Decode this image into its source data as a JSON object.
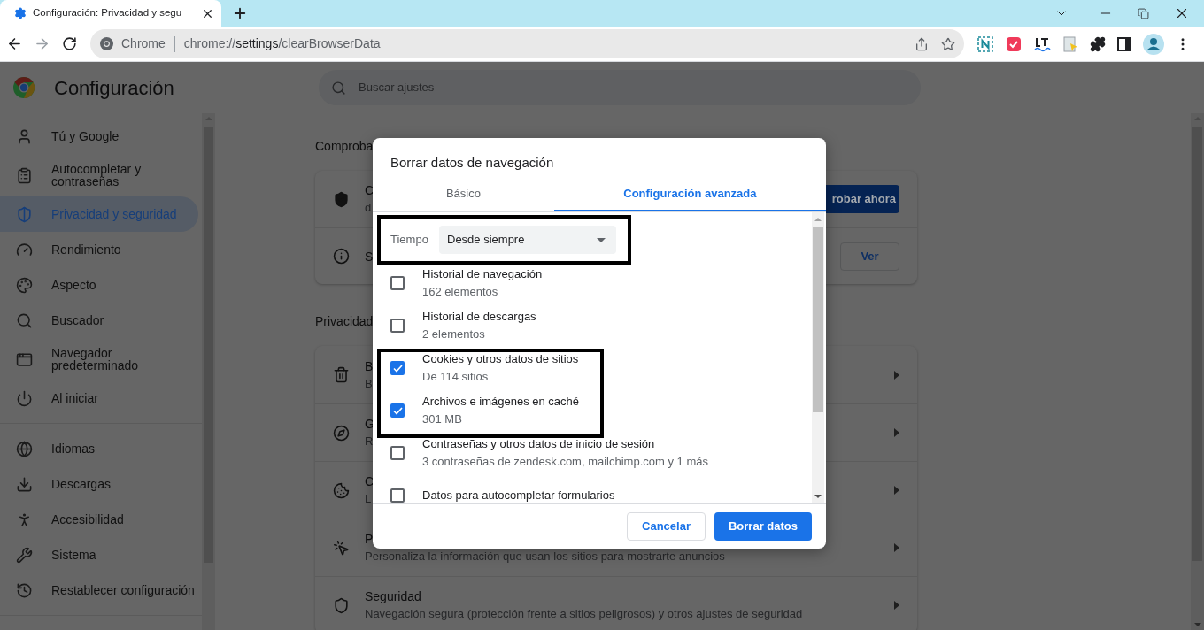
{
  "browser": {
    "tab": {
      "title": "Configuración: Privacidad y segu",
      "selected": true
    },
    "omnibox": {
      "site": "Chrome",
      "url_scheme": "chrome://",
      "url_host": "settings",
      "url_path": "/clearBrowserData"
    }
  },
  "settings": {
    "title": "Configuración",
    "search": {
      "placeholder": "Buscar ajustes"
    },
    "sidebar": {
      "groups": [
        [
          {
            "label": "Tú y Google",
            "selected": false
          },
          {
            "label": "Autocompletar y\ncontraseñas",
            "selected": false
          },
          {
            "label": "Privacidad y seguridad",
            "selected": true
          },
          {
            "label": "Rendimiento",
            "selected": false
          },
          {
            "label": "Aspecto",
            "selected": false
          },
          {
            "label": "Buscador",
            "selected": false
          },
          {
            "label": "Navegador\npredeterminado",
            "selected": false
          },
          {
            "label": "Al iniciar",
            "selected": false
          }
        ],
        [
          {
            "label": "Idiomas",
            "selected": false
          },
          {
            "label": "Descargas",
            "selected": false
          },
          {
            "label": "Accesibilidad",
            "selected": false
          },
          {
            "label": "Sistema",
            "selected": false
          },
          {
            "label": "Restablecer configuración",
            "selected": false
          }
        ]
      ]
    },
    "sections": [
      {
        "heading": "Comproba",
        "rows": [
          {
            "title": "C",
            "subtitle": "d",
            "button": {
              "label": "robar ahora",
              "kind": "primary"
            }
          },
          {
            "title": "S",
            "button": {
              "label": "Ver",
              "kind": "outline"
            }
          }
        ]
      },
      {
        "heading": "Privacidad",
        "rows": [
          {
            "title": "B",
            "subtitle": "B"
          },
          {
            "title": "G",
            "subtitle": "R"
          },
          {
            "title": "C",
            "subtitle": "L"
          },
          {
            "title": "P",
            "subtitle": "Personaliza la información que usan los sitios para mostrarte anuncios"
          },
          {
            "title": "Seguridad",
            "subtitle": "Navegación segura (protección frente a sitios peligrosos) y otros ajustes de seguridad"
          }
        ]
      }
    ]
  },
  "dialog": {
    "title": "Borrar datos de navegación",
    "tabs": [
      {
        "label": "Básico",
        "selected": false
      },
      {
        "label": "Configuración avanzada",
        "selected": true
      }
    ],
    "time_range": {
      "label": "Tiempo",
      "value": "Desde siempre"
    },
    "items": [
      {
        "title": "Historial de navegación",
        "detail": "162 elementos",
        "checked": false
      },
      {
        "title": "Historial de descargas",
        "detail": "2 elementos",
        "checked": false
      },
      {
        "title": "Cookies y otros datos de sitios",
        "detail": "De 114 sitios",
        "checked": true
      },
      {
        "title": "Archivos e imágenes en caché",
        "detail": "301 MB",
        "checked": true
      },
      {
        "title": "Contraseñas y otros datos de inicio de sesión",
        "detail": "3 contraseñas de zendesk.com, mailchimp.com y 1 más",
        "checked": false
      },
      {
        "title": "Datos para autocompletar formularios",
        "checked": false
      }
    ],
    "buttons": [
      {
        "label": "Cancelar",
        "kind": "secondary"
      },
      {
        "label": "Borrar datos",
        "kind": "primary"
      }
    ]
  }
}
